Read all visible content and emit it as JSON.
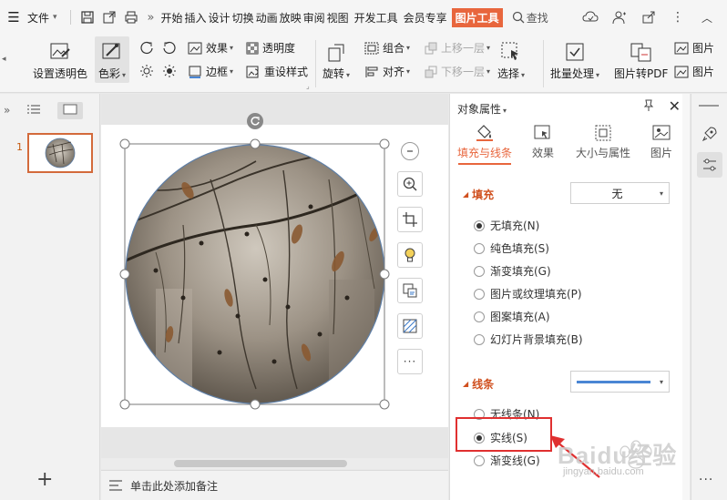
{
  "menubar": {
    "file_label": "文件",
    "tabs": [
      "开始",
      "插入",
      "设计",
      "切换",
      "动画",
      "放映",
      "审阅",
      "视图",
      "开发工具",
      "会员专享"
    ],
    "active_tab": "图片工具",
    "search_label": "查找"
  },
  "ribbon": {
    "set_transparent": "设置透明色",
    "color": "色彩",
    "effects": "效果",
    "transparency": "透明度",
    "border": "边框",
    "reset_style": "重设样式",
    "rotate": "旋转",
    "group": "组合",
    "align": "对齐",
    "bring_forward": "上移一层",
    "send_backward": "下移一层",
    "select": "选择",
    "batch": "批量处理",
    "to_pdf": "图片转PDF",
    "image_right1": "图片",
    "image_right2": "图片"
  },
  "slides": {
    "first_number": "1"
  },
  "notes": {
    "placeholder": "单击此处添加备注"
  },
  "props": {
    "title": "对象属性",
    "tabs": [
      "填充与线条",
      "效果",
      "大小与属性",
      "图片"
    ],
    "fill": {
      "heading": "填充",
      "dropdown_value": "无",
      "options": [
        "无填充(N)",
        "纯色填充(S)",
        "渐变填充(G)",
        "图片或纹理填充(P)",
        "图案填充(A)",
        "幻灯片背景填充(B)"
      ],
      "selected_index": 0
    },
    "line": {
      "heading": "线条",
      "options": [
        "无线条(N)",
        "实线(S)",
        "渐变线(G)"
      ],
      "selected_index": 1
    }
  },
  "watermark": {
    "brand": "Baidu经验",
    "url": "jingyan.baidu.com"
  },
  "colors": {
    "accent": "#e8663d",
    "highlight": "#e03030",
    "line_blue": "#4a86d4"
  }
}
